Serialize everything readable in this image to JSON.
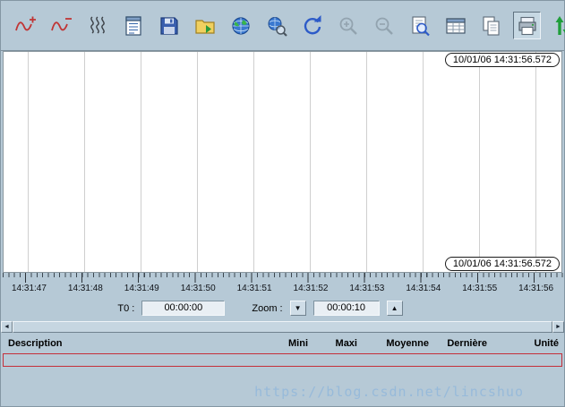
{
  "toolbar": {
    "icons": [
      "add-curve",
      "remove-curve",
      "curves",
      "curve-list",
      "save",
      "open-folder",
      "network-globe",
      "globe-search",
      "refresh",
      "zoom-in",
      "zoom-out",
      "preview",
      "report-table",
      "copy",
      "print",
      "fit-vertical"
    ],
    "selected_icon": "print",
    "disabled_icons": [
      "zoom-in",
      "zoom-out"
    ]
  },
  "chart": {
    "top_timestamp": "10/01/06 14:31:56.572",
    "bottom_timestamp": "10/01/06 14:31:56.572",
    "axis_ticks": [
      "14:31:47",
      "14:31:48",
      "14:31:49",
      "14:31:50",
      "14:31:51",
      "14:31:52",
      "14:31:53",
      "14:31:54",
      "14:31:55",
      "14:31:56"
    ]
  },
  "controls": {
    "t0_label": "T0 :",
    "t0_value": "00:00:00",
    "zoom_label": "Zoom :",
    "zoom_value": "00:00:10",
    "zoom_down_glyph": "▼",
    "zoom_up_glyph": "▲"
  },
  "scrollbar": {
    "left_glyph": "◄",
    "right_glyph": "►"
  },
  "table": {
    "headers": [
      "Description",
      "Mini",
      "Maxi",
      "Moyenne",
      "Dernière",
      "Unité"
    ]
  },
  "watermark": "https://blog.csdn.net/lincshuo",
  "colors": {
    "background": "#b6c9d6",
    "chart_background": "#ffffff",
    "gridline": "#cfcfcf",
    "list_border_red": "#c52f3a",
    "watermark_blue": "#96b9da"
  }
}
